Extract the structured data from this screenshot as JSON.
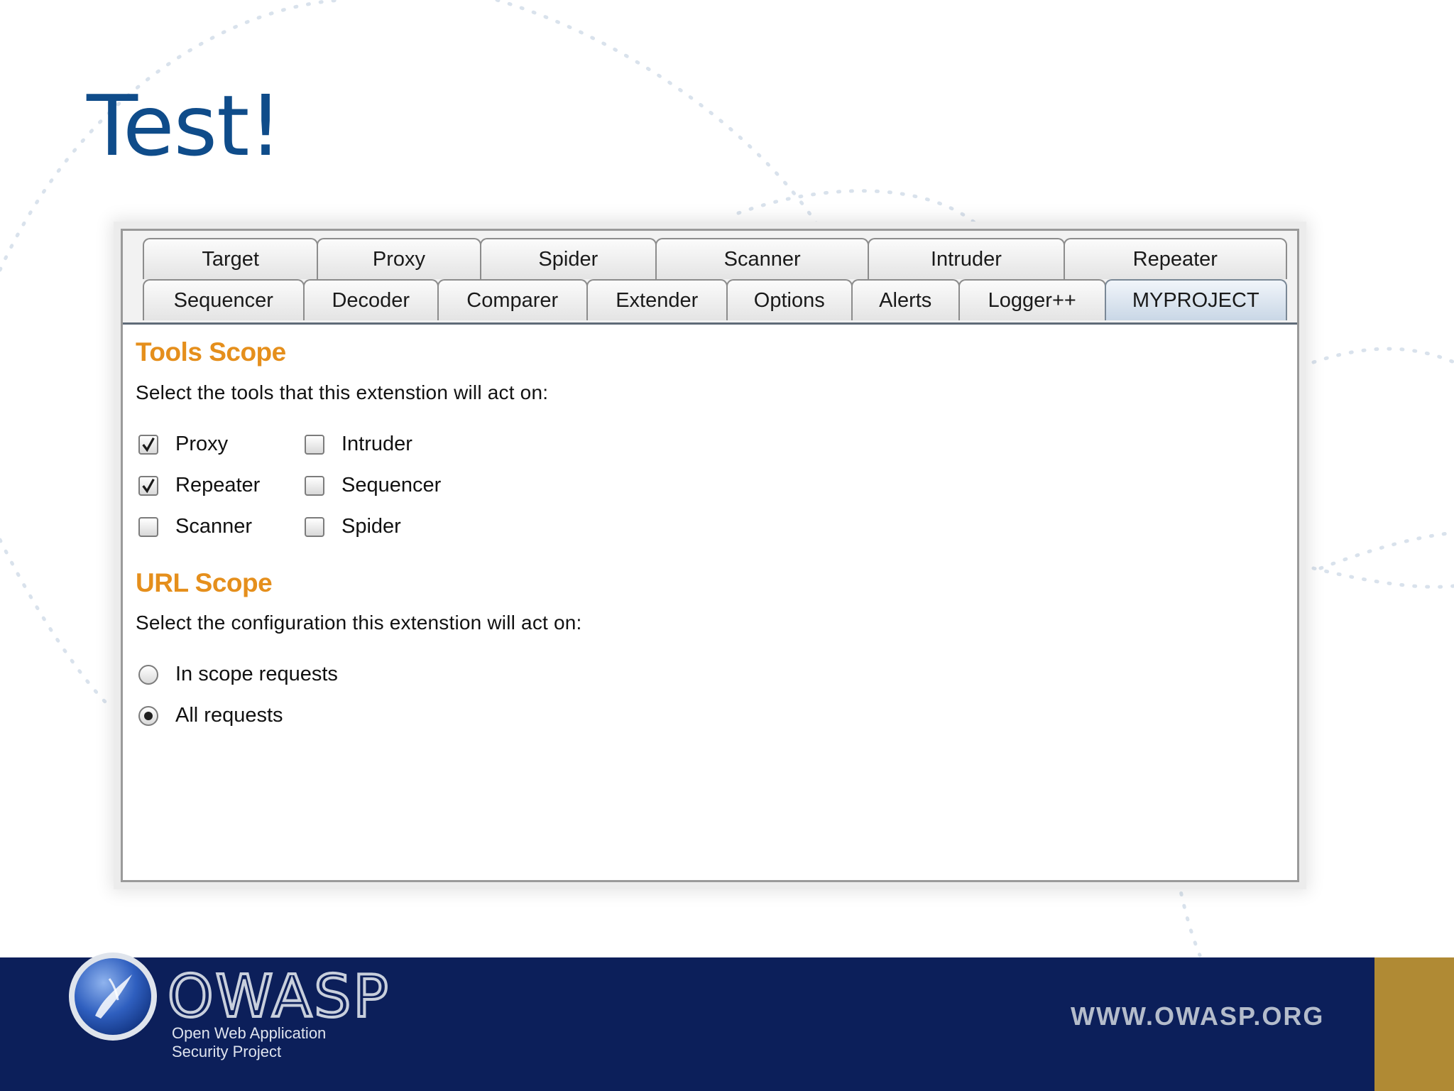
{
  "slide": {
    "title": "Test!"
  },
  "tabs": {
    "row1": [
      "Target",
      "Proxy",
      "Spider",
      "Scanner",
      "Intruder",
      "Repeater"
    ],
    "row2": [
      "Sequencer",
      "Decoder",
      "Comparer",
      "Extender",
      "Options",
      "Alerts",
      "Logger++",
      "MYPROJECT"
    ],
    "selected": "MYPROJECT"
  },
  "tools_scope": {
    "heading": "Tools Scope",
    "description": "Select the tools that this extenstion will act on:",
    "options": [
      {
        "label": "Proxy",
        "checked": true
      },
      {
        "label": "Repeater",
        "checked": true
      },
      {
        "label": "Scanner",
        "checked": false
      },
      {
        "label": "Intruder",
        "checked": false
      },
      {
        "label": "Sequencer",
        "checked": false
      },
      {
        "label": "Spider",
        "checked": false
      }
    ]
  },
  "url_scope": {
    "heading": "URL Scope",
    "description": "Select the configuration this extenstion will act on:",
    "options": [
      {
        "label": "In scope requests",
        "selected": false
      },
      {
        "label": "All requests",
        "selected": true
      }
    ]
  },
  "footer": {
    "brand_name": "OWASP",
    "tagline_line1": "Open Web Application",
    "tagline_line2": "Security Project",
    "url": "WWW.OWASP.ORG"
  },
  "colors": {
    "title_blue": "#0f4c8a",
    "heading_orange": "#e58f1c",
    "footer_navy": "#0c1f5a",
    "footer_gold": "#b08a34",
    "selected_tab": "#c9d7e6"
  },
  "icons": [
    "owasp-globe-icon",
    "checkmark-icon"
  ]
}
